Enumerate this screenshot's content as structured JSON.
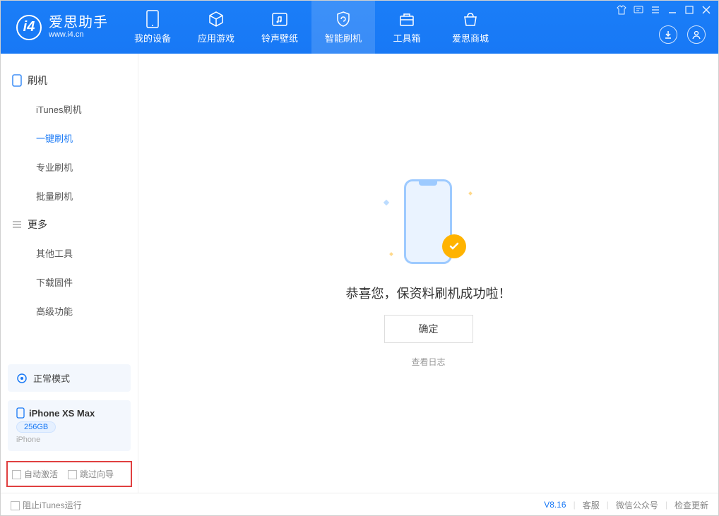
{
  "app": {
    "title": "爱思助手",
    "subtitle": "www.i4.cn"
  },
  "nav": {
    "tabs": [
      {
        "label": "我的设备"
      },
      {
        "label": "应用游戏"
      },
      {
        "label": "铃声壁纸"
      },
      {
        "label": "智能刷机"
      },
      {
        "label": "工具箱"
      },
      {
        "label": "爱思商城"
      }
    ]
  },
  "sidebar": {
    "section1": {
      "title": "刷机",
      "items": [
        "iTunes刷机",
        "一键刷机",
        "专业刷机",
        "批量刷机"
      ]
    },
    "section2": {
      "title": "更多",
      "items": [
        "其他工具",
        "下载固件",
        "高级功能"
      ]
    },
    "mode": "正常模式",
    "device": {
      "name": "iPhone XS Max",
      "capacity": "256GB",
      "type": "iPhone"
    },
    "options": {
      "auto_activate": "自动激活",
      "skip_guide": "跳过向导"
    }
  },
  "main": {
    "success_text": "恭喜您，保资料刷机成功啦！",
    "ok_button": "确定",
    "view_log": "查看日志"
  },
  "statusbar": {
    "block_itunes": "阻止iTunes运行",
    "version": "V8.16",
    "links": [
      "客服",
      "微信公众号",
      "检查更新"
    ]
  }
}
